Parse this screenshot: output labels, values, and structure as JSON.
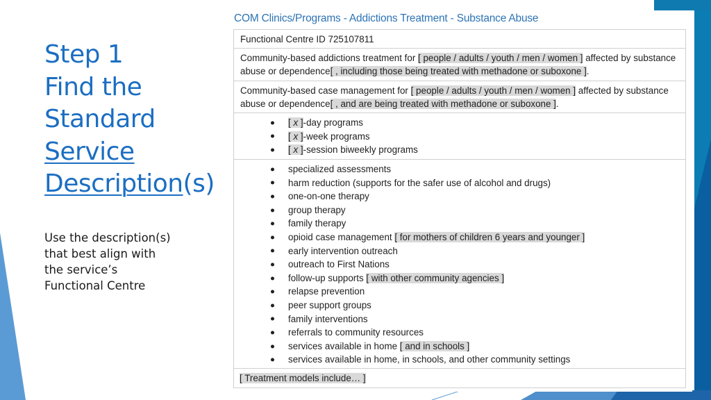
{
  "colors": {
    "title_blue": "#1b6ec2",
    "heading_blue": "#2e74b5",
    "highlight_gray": "#d9d9d9",
    "deco_light_blue": "#5b9bd5",
    "deco_teal_blue": "#0e7ab0",
    "deco_dark_blue": "#0a5fa0"
  },
  "slide": {
    "title_lines": [
      "Step 1",
      "Find the",
      "Standard"
    ],
    "title_link_1": "Service",
    "title_link_2": "Description",
    "title_suffix": "(s)",
    "subtitle_lines": [
      "Use the description(s)",
      "that best align with",
      "the service’s",
      "Functional Centre"
    ]
  },
  "document": {
    "heading": "COM Clinics/Programs - Addictions Treatment - Substance Abuse",
    "functional_centre": "Functional Centre ID 725107811",
    "description_1": {
      "prefix": "Community-based addictions treatment for ",
      "option_1": "[ people / adults / youth / men / women ]",
      "middle": " affected by substance abuse or dependence",
      "option_2": "[ , including those being treated with methadone or suboxone ]",
      "suffix": "."
    },
    "description_2": {
      "prefix": "Community-based case management for ",
      "option_1": "[ people / adults / youth / men / women ]",
      "middle": " affected by substance abuse or dependence",
      "option_2": "[ , and are being treated with methadone or suboxone ]",
      "suffix": "."
    },
    "program_types": [
      {
        "open": "[ ",
        "var": "x",
        "close": " ]",
        "text": "-day programs"
      },
      {
        "open": "[ ",
        "var": "x",
        "close": " ]",
        "text": "-week programs"
      },
      {
        "open": "[ ",
        "var": "x",
        "close": " ]",
        "text": "-session biweekly programs"
      }
    ],
    "services": [
      {
        "text": "specialized assessments",
        "option": ""
      },
      {
        "text": "harm reduction (supports for the safer use of alcohol and drugs)",
        "option": ""
      },
      {
        "text": "one-on-one therapy",
        "option": ""
      },
      {
        "text": "group therapy",
        "option": ""
      },
      {
        "text": "family therapy",
        "option": ""
      },
      {
        "text": "opioid case management ",
        "option": "[ for mothers of children 6 years and younger ]"
      },
      {
        "text": "early intervention outreach",
        "option": ""
      },
      {
        "text": "outreach to First Nations",
        "option": ""
      },
      {
        "text": "follow-up supports ",
        "option": "[ with other community agencies ]"
      },
      {
        "text": "relapse prevention",
        "option": ""
      },
      {
        "text": "peer support groups",
        "option": ""
      },
      {
        "text": "family interventions",
        "option": ""
      },
      {
        "text": "referrals to community resources",
        "option": ""
      },
      {
        "text": "services available in home ",
        "option": "[ and in schools ]"
      },
      {
        "text": "services available in home, in schools, and other community settings",
        "option": ""
      }
    ],
    "treatment_models": "[ Treatment models include… ]"
  }
}
